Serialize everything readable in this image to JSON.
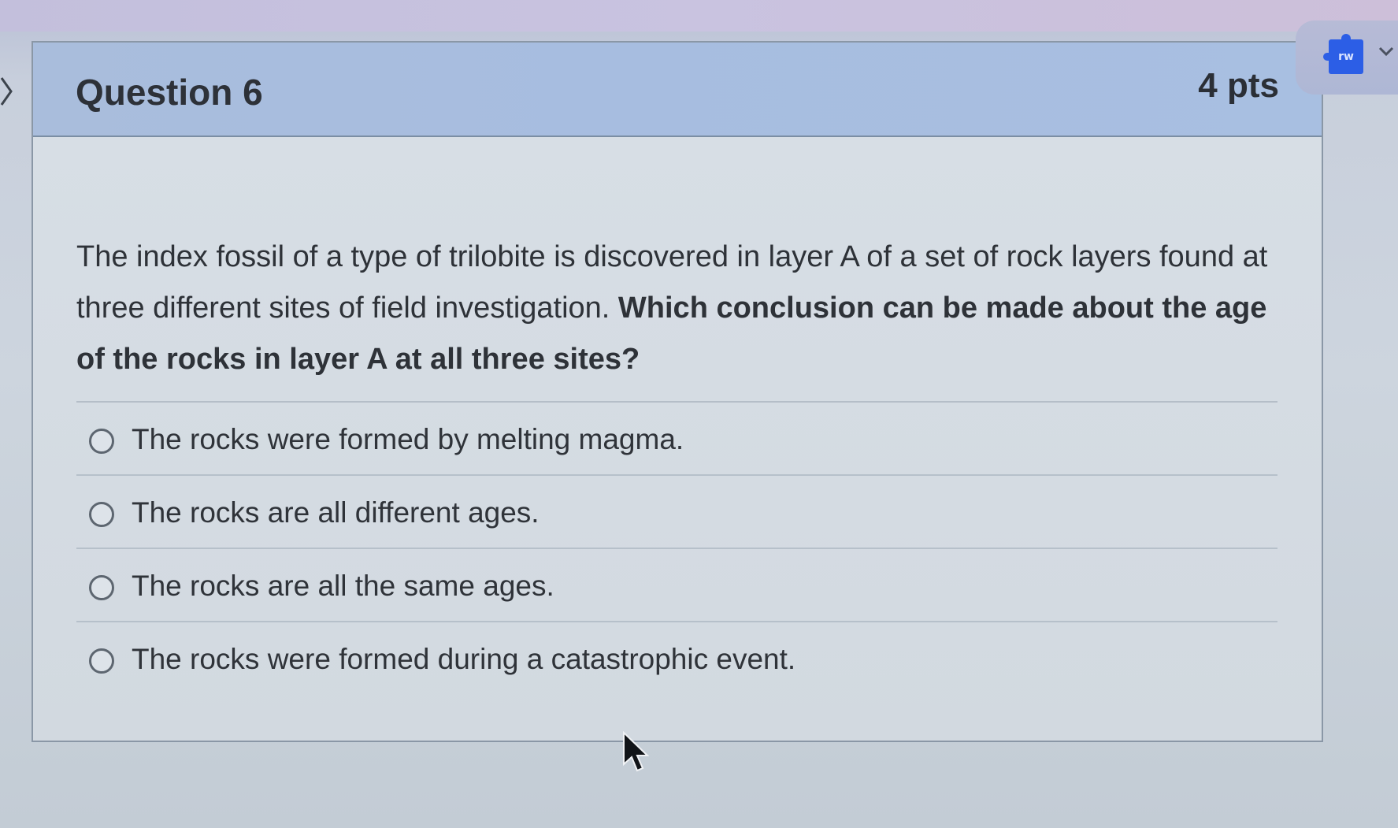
{
  "question": {
    "title": "Question 6",
    "points": "4 pts",
    "text_plain": "The index fossil of a type of trilobite is discovered in layer A of a set of rock layers found at three different sites of field investigation.",
    "text_emphasis": "Which conclusion can be made about the age of the rocks in layer A at all three sites?"
  },
  "answers": [
    {
      "label": "The rocks were formed by melting magma."
    },
    {
      "label": "The rocks are all different ages."
    },
    {
      "label": "The rocks are all the same ages."
    },
    {
      "label": "The rocks were formed during a catastrophic event."
    }
  ],
  "widget": {
    "icon_text": "rw",
    "icon_name": "puzzle-icon"
  },
  "colors": {
    "header_bg": "#a9bddc",
    "body_bg": "#d7dee5",
    "widget_icon": "#2c5ee6"
  }
}
